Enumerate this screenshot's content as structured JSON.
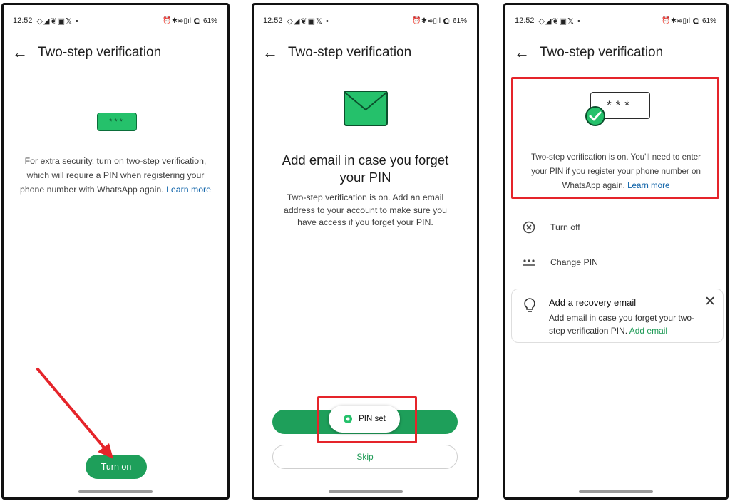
{
  "statusbar": {
    "time": "12:52",
    "left_icons": "◇◢❦▣𝕏 •",
    "right_icons": "⏰✱≋▯ıl",
    "battery": "61%"
  },
  "phone1": {
    "title": "Two-step verification",
    "pin_mask": "***",
    "description": "For extra security, turn on two-step verification, which will require a PIN when registering your phone number with WhatsApp again.",
    "learn_more": "Learn more",
    "turn_on_button": "Turn on"
  },
  "phone2": {
    "title": "Two-step verification",
    "heading": "Add email in case you forget your PIN",
    "description": "Two-step verification is on. Add an email address to your account to make sure you have access if you forget your PIN.",
    "snackbar": "PIN set",
    "skip_button": "Skip"
  },
  "phone3": {
    "title": "Two-step verification",
    "pin_mask": "***",
    "description": "Two-step verification is on. You'll need to enter your PIN if you register your phone number on WhatsApp again.",
    "learn_more": "Learn more",
    "menu": [
      {
        "label": "Turn off",
        "icon": "x-circle-icon"
      },
      {
        "label": "Change PIN",
        "icon": "dots-icon"
      }
    ],
    "recovery": {
      "title": "Add a recovery email",
      "body": "Add email in case you forget your two-step verification PIN.",
      "link": "Add email"
    }
  },
  "colors": {
    "accent_green": "#1e9f5a",
    "highlight_red": "#e5242a",
    "link_blue": "#0d62a8"
  }
}
